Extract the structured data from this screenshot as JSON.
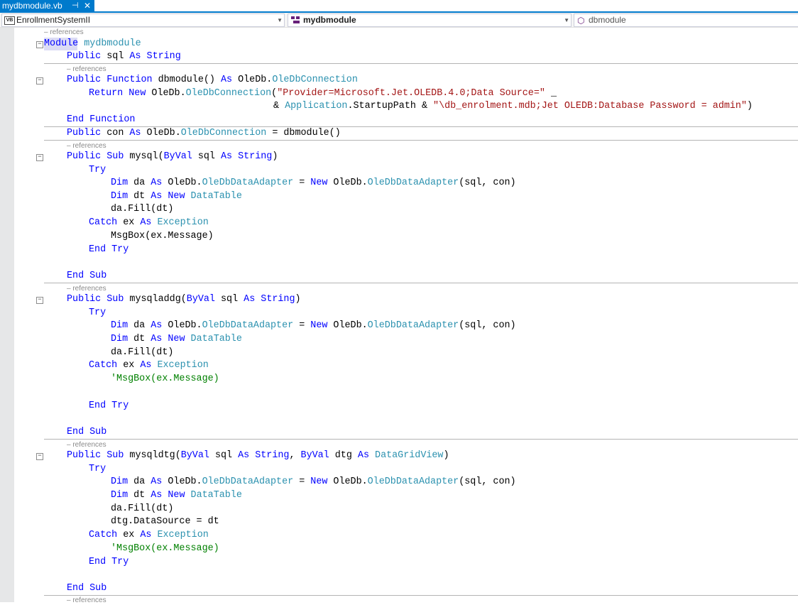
{
  "tab": {
    "title": "mydbmodule.vb",
    "pin": "⊣",
    "close": "✕"
  },
  "navbar": {
    "project": "EnrollmentSystemII",
    "module": "mydbmodule",
    "member": "dbmodule"
  },
  "references_label": "– references",
  "colors": {
    "keyword": "#0000ff",
    "type": "#2b91af",
    "string": "#a31515",
    "comment": "#008000",
    "accent": "#007acc"
  },
  "icons": [
    "vb-file-icon",
    "module-icon",
    "method-icon",
    "pin-icon",
    "close-icon",
    "collapse-icon"
  ],
  "code": {
    "module_kw": "Module",
    "module_name": "mydbmodule",
    "end_function": "End Function",
    "end_sub": "End Sub",
    "try": "Try",
    "end_try": "End Try",
    "catch": "Catch",
    "catch_rest": " ex ",
    "as": "As",
    "exception": "Exception",
    "msgbox": "MsgBox(ex.Message)",
    "msgbox_comment": "'MsgBox(ex.Message)",
    "dim": "Dim",
    "da_rest": " da ",
    "oledb1": " OleDb.",
    "adapter_type": "OleDbDataAdapter",
    "eq": " = ",
    "new": "New",
    "adapter_args": "(sql, con)",
    "dt_rest": " dt ",
    "datatable": "DataTable",
    "fill": "da.Fill(dt)",
    "datasource": "dtg.DataSource = dt",
    "sp": " ",
    "l1_public": "Public",
    "l1_rest": " sql ",
    "l1_string": "String",
    "f_public": "Public",
    "f_function": "Function",
    "f_name": " dbmodule() ",
    "f_oledb": " OleDb.",
    "f_conn": "OleDbConnection",
    "r_return": "Return",
    "r_new": "New",
    "r_oledb": " OleDb.",
    "r_conn": "OleDbConnection",
    "r_paren": "(",
    "r_str": "\"Provider=Microsoft.Jet.OLEDB.4.0;Data Source=\"",
    "r_cont": " _",
    "a_amp": "& ",
    "a_app": "Application",
    "a_rest": ".StartupPath & ",
    "a_str": "\"\\db_enrolment.mdb;Jet OLEDB:Database Password = admin\"",
    "a_close": ")",
    "con_public": "Public",
    "con_rest": " con ",
    "con_oledb": " OleDb.",
    "con_type": "OleDbConnection",
    "con_tail": " = dbmodule()",
    "s1_public": "Public",
    "s1_sub": "Sub",
    "s1_name": " mysql(",
    "byval": "ByVal",
    "s_sqlp": " sql ",
    "string": "String",
    "close_paren": ")",
    "s2_name": " mysqladdg(",
    "s3_name": " mysqldtg(",
    "s3_comma": ", ",
    "s3_dtg": " dtg ",
    "dgv": "DataGridView"
  }
}
